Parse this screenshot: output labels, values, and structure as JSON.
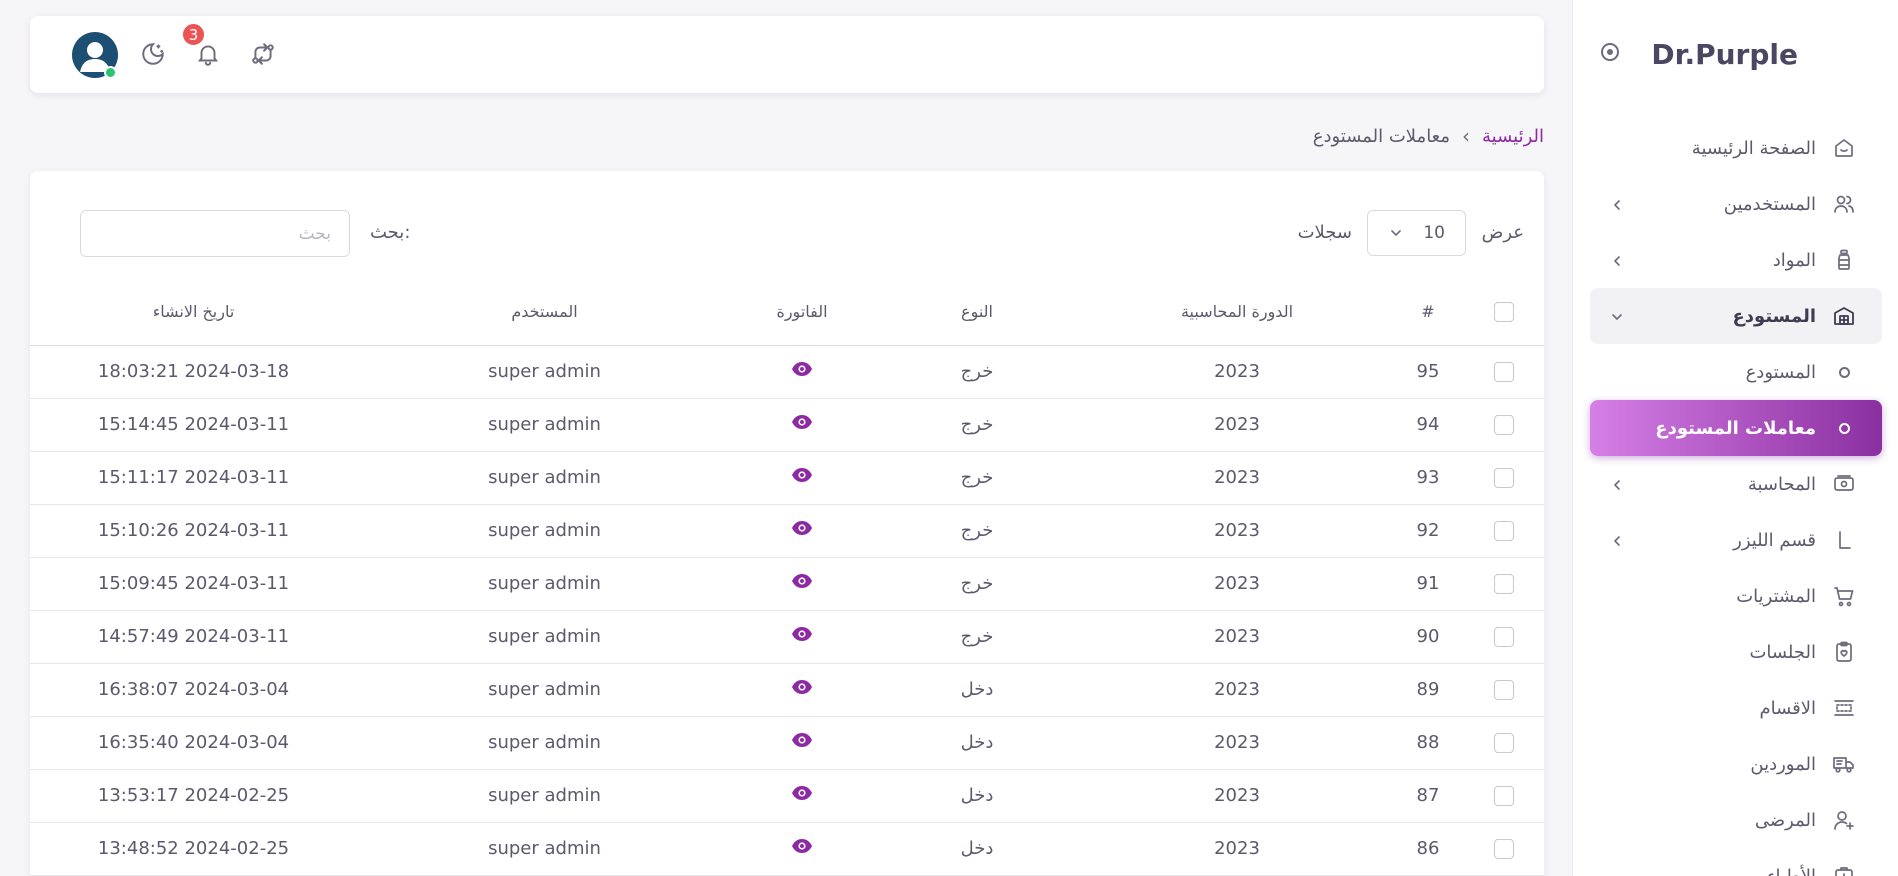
{
  "brand": {
    "name": "Dr.Purple"
  },
  "sidebar": {
    "items": [
      {
        "label": "الصفحة الرئيسية",
        "icon": "home-icon",
        "chevron": false
      },
      {
        "label": "المستخدمين",
        "icon": "users-icon",
        "chevron": true
      },
      {
        "label": "المواد",
        "icon": "bottle-icon",
        "chevron": true
      },
      {
        "label": "المستودع",
        "icon": "warehouse-icon",
        "chevron": true,
        "open": true
      },
      {
        "label": "المستودع",
        "sub": true
      },
      {
        "label": "معاملات المستودع",
        "sub": true,
        "active": true
      },
      {
        "label": "المحاسبة",
        "icon": "cash-icon",
        "chevron": true
      },
      {
        "label": "قسم الليزر",
        "icon": "laser-icon",
        "chevron": true
      },
      {
        "label": "المشتريات",
        "icon": "cart-icon",
        "chevron": false
      },
      {
        "label": "الجلسات",
        "icon": "clipboard-icon",
        "chevron": false
      },
      {
        "label": "الاقسام",
        "icon": "sections-icon",
        "chevron": false
      },
      {
        "label": "الموردين",
        "icon": "truck-icon",
        "chevron": false
      },
      {
        "label": "المرضى",
        "icon": "user-plus-icon",
        "chevron": false
      },
      {
        "label": "الأطباء",
        "icon": "doctor-icon",
        "chevron": false
      }
    ]
  },
  "navbar": {
    "notification_count": "3"
  },
  "breadcrumb": {
    "home": "الرئيسية",
    "separator": "›",
    "current": "معاملات المستودع"
  },
  "table_controls": {
    "show_label": "عرض",
    "page_length": "10",
    "records_label": "سجلات",
    "search_label": "بحث:",
    "search_placeholder": "بحث"
  },
  "table": {
    "headers": {
      "num": "#",
      "period": "الدورة المحاسبية",
      "type": "النوع",
      "invoice": "الفاتورة",
      "user": "المستخدم",
      "date": "تاريخ الانشاء"
    },
    "rows": [
      {
        "num": "95",
        "period": "2023",
        "type": "خرج",
        "user": "super admin",
        "date": "2024-03-18 18:03:21"
      },
      {
        "num": "94",
        "period": "2023",
        "type": "خرج",
        "user": "super admin",
        "date": "2024-03-11 15:14:45"
      },
      {
        "num": "93",
        "period": "2023",
        "type": "خرج",
        "user": "super admin",
        "date": "2024-03-11 15:11:17"
      },
      {
        "num": "92",
        "period": "2023",
        "type": "خرج",
        "user": "super admin",
        "date": "2024-03-11 15:10:26"
      },
      {
        "num": "91",
        "period": "2023",
        "type": "خرج",
        "user": "super admin",
        "date": "2024-03-11 15:09:45"
      },
      {
        "num": "90",
        "period": "2023",
        "type": "خرج",
        "user": "super admin",
        "date": "2024-03-11 14:57:49"
      },
      {
        "num": "89",
        "period": "2023",
        "type": "دخل",
        "user": "super admin",
        "date": "2024-03-04 16:38:07"
      },
      {
        "num": "88",
        "period": "2023",
        "type": "دخل",
        "user": "super admin",
        "date": "2024-03-04 16:35:40"
      },
      {
        "num": "87",
        "period": "2023",
        "type": "دخل",
        "user": "super admin",
        "date": "2024-02-25 13:53:17"
      },
      {
        "num": "86",
        "period": "2023",
        "type": "دخل",
        "user": "super admin",
        "date": "2024-02-25 13:48:52"
      }
    ]
  },
  "colors": {
    "accent": "#8d2aa3",
    "active_gradient_start": "#8a2fa0",
    "active_gradient_end": "#d67fe6",
    "online": "#28c76f",
    "badge": "#ea5455"
  }
}
